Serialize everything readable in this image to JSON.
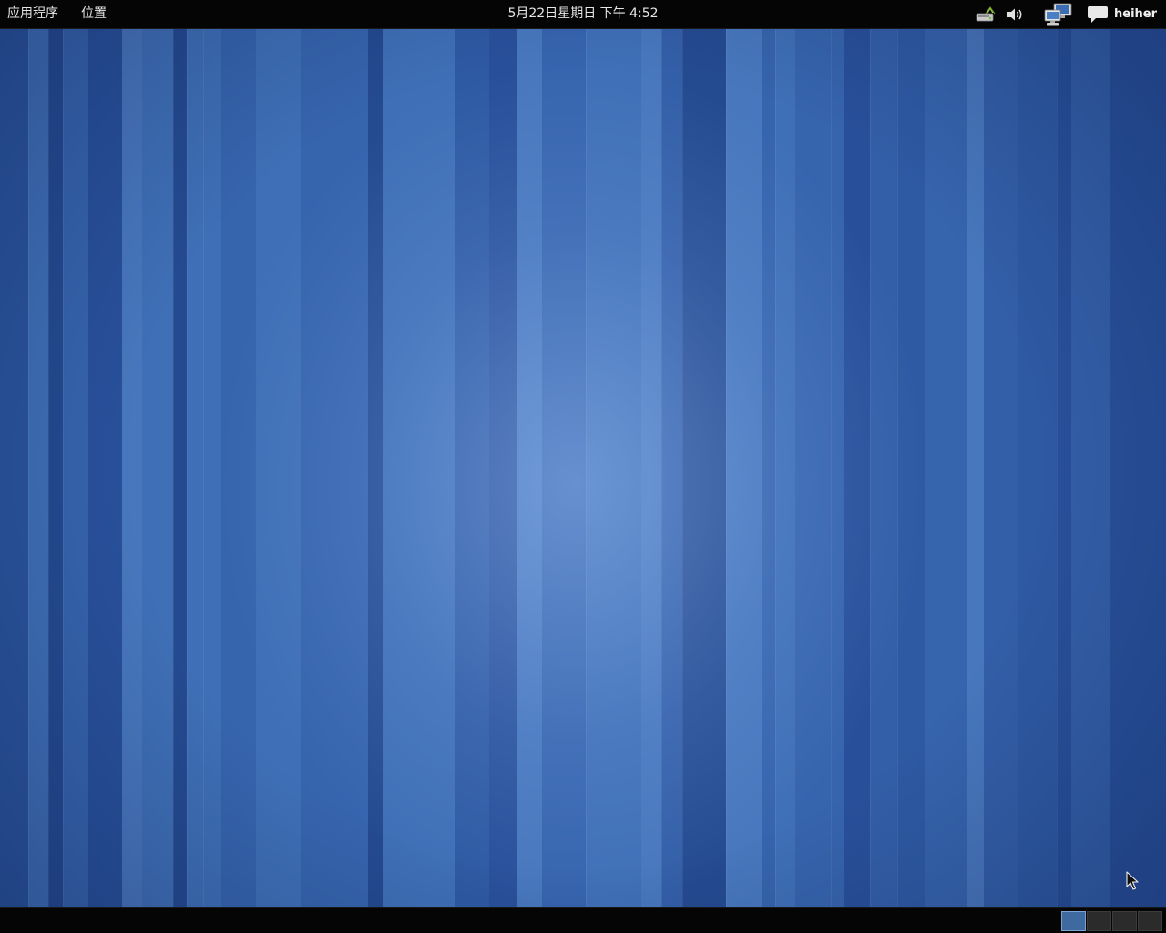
{
  "top_panel": {
    "apps_menu_label": "应用程序",
    "places_menu_label": "位置",
    "clock": "5月22日星期日 下午  4:52",
    "tray_icons": [
      "bluetooth-icon",
      "volume-icon",
      "network-icon",
      "chat-icon"
    ],
    "user_name": "heiher"
  },
  "bottom_panel": {
    "workspaces": [
      {
        "active": true
      },
      {
        "active": false
      },
      {
        "active": false
      },
      {
        "active": false
      }
    ]
  },
  "colors": {
    "panel": "#050505",
    "wallpaper_base": "#2f5a9a",
    "workspace_active": "#3e6aa0"
  }
}
